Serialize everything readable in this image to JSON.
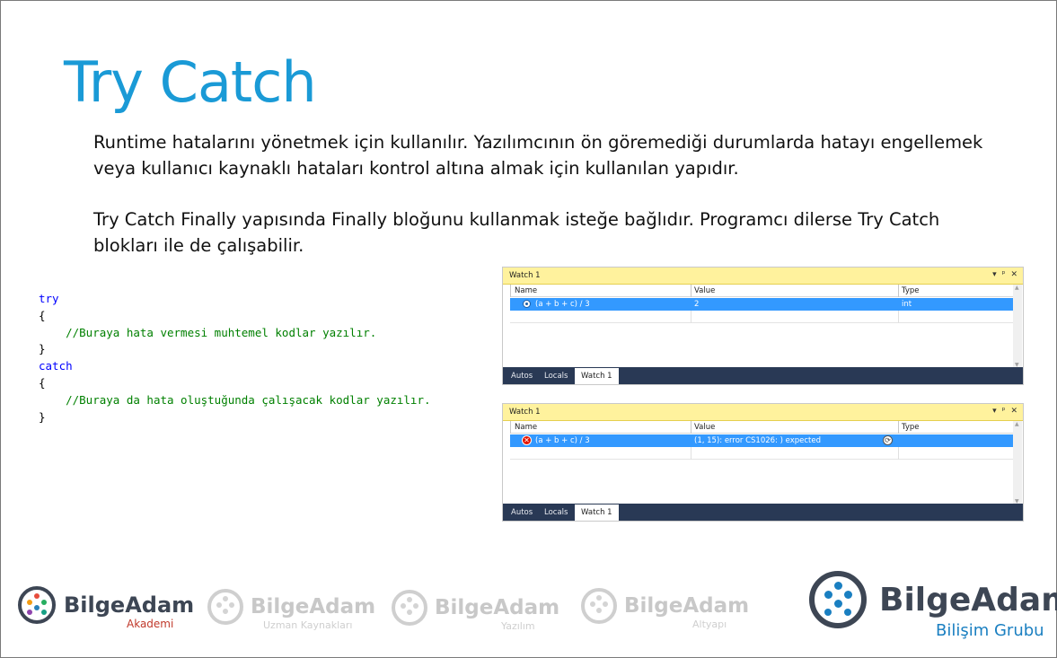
{
  "slide": {
    "title": "Try Catch",
    "paragraphs": [
      "Runtime hatalarını yönetmek için kullanılır. Yazılımcının ön göremediği durumlarda hatayı engellemek veya kullanıcı kaynaklı hataları kontrol altına almak için kullanılan yapıdır.",
      "Try Catch Finally yapısında Finally bloğunu kullanmak isteğe bağlıdır. Programcı dilerse Try Catch blokları ile de çalışabilir."
    ]
  },
  "code": {
    "try_keyword": "try",
    "open_brace": "{",
    "try_comment": "//Buraya hata vermesi muhtemel kodlar yazılır.",
    "close_brace": "}",
    "catch_keyword": "catch",
    "catch_comment": "//Buraya da hata oluştuğunda çalışacak kodlar yazılır."
  },
  "watch_windows": [
    {
      "title": "Watch 1",
      "controls": [
        "▾",
        "ᵖ",
        "✕"
      ],
      "columns": [
        "Name",
        "Value",
        "Type"
      ],
      "row": {
        "name": "(a + b + c) / 3",
        "value": "2",
        "type": "int",
        "icon": "watch-icon"
      },
      "tabs": [
        "Autos",
        "Locals",
        "Watch 1"
      ],
      "active_tab": "Watch 1"
    },
    {
      "title": "Watch 1",
      "controls": [
        "▾",
        "ᵖ",
        "✕"
      ],
      "columns": [
        "Name",
        "Value",
        "Type"
      ],
      "row": {
        "name": "(a + b + c) / 3",
        "value": "(1, 15): error CS1026: ) expected",
        "type": "",
        "icon": "error-icon"
      },
      "tabs": [
        "Autos",
        "Locals",
        "Watch 1"
      ],
      "active_tab": "Watch 1"
    }
  ],
  "footer": {
    "logos": [
      {
        "name": "BilgeAdam",
        "sub": "Akademi",
        "color": "#3d4654",
        "sub_color": "#c0392b"
      },
      {
        "name": "BilgeAdam",
        "sub": "Uzman Kaynakları",
        "color": "#c8c8c8",
        "sub_color": "#cfcfcf"
      },
      {
        "name": "BilgeAdam",
        "sub": "Yazılım",
        "color": "#c8c8c8",
        "sub_color": "#cfcfcf"
      },
      {
        "name": "BilgeAdam",
        "sub": "Altyapı",
        "color": "#c8c8c8",
        "sub_color": "#cfcfcf"
      }
    ],
    "main_logo": {
      "name": "BilgeAdam",
      "sub": "Bilişim Grubu",
      "color": "#3d4654",
      "sub_color": "#1a7fc1"
    }
  },
  "colors": {
    "title": "#1a9ad6",
    "keyword": "#0000ff",
    "comment": "#008000",
    "watch_header": "#fff29d",
    "watch_tabbar": "#293955",
    "selection": "#3399ff"
  }
}
